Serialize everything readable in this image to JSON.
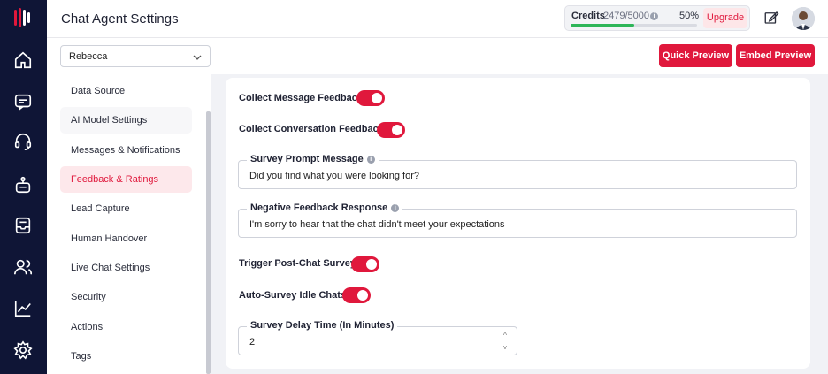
{
  "header": {
    "title": "Chat Agent Settings",
    "credits_label": "Credits",
    "credits_count": "2479/5000",
    "credits_percent": "50%",
    "credits_fraction": 0.5,
    "upgrade_label": "Upgrade"
  },
  "toolbar": {
    "agent_value": "Rebecca",
    "quick_preview_label": "Quick Preview",
    "embed_preview_label": "Embed Preview"
  },
  "nav": {
    "items": [
      {
        "label": "Data Source"
      },
      {
        "label": "AI Model Settings"
      },
      {
        "label": "Messages & Notifications"
      },
      {
        "label": "Feedback & Ratings"
      },
      {
        "label": "Lead Capture"
      },
      {
        "label": "Human Handover"
      },
      {
        "label": "Live Chat Settings"
      },
      {
        "label": "Security"
      },
      {
        "label": "Actions"
      },
      {
        "label": "Tags"
      }
    ],
    "active_label": "Feedback & Ratings"
  },
  "form": {
    "collect_message_feedback": {
      "label": "Collect Message Feedback",
      "on": true
    },
    "collect_conversation_feedback": {
      "label": "Collect Conversation Feedback",
      "on": true
    },
    "survey_prompt": {
      "label": "Survey Prompt Message",
      "value": "Did you find what you were looking for?"
    },
    "negative_feedback": {
      "label": "Negative Feedback Response",
      "value": "I'm sorry to hear that the chat didn't meet your expectations"
    },
    "trigger_post_chat_survey": {
      "label": "Trigger Post-Chat Survey",
      "on": true
    },
    "auto_survey_idle": {
      "label": "Auto-Survey Idle Chats",
      "on": true
    },
    "survey_delay": {
      "label": "Survey Delay Time (In Minutes)",
      "value": "2"
    }
  },
  "colors": {
    "accent": "#e0183c",
    "rail": "#0f1536",
    "credits_bar": "#2db558"
  },
  "icons": {
    "rail": [
      "logo-icon",
      "home-icon",
      "chat-icon",
      "headset-icon",
      "bot-icon",
      "inbox-icon",
      "users-icon",
      "analytics-icon",
      "settings-icon"
    ]
  }
}
